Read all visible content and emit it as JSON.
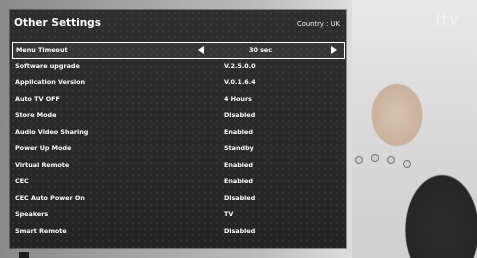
{
  "header": {
    "title": "Other Settings",
    "country": "Country : UK"
  },
  "broadcaster": {
    "logo_text": "itv"
  },
  "settings": [
    {
      "label": "Menu Timeout",
      "value": "30 sec",
      "selected": true
    },
    {
      "label": "Software upgrade",
      "value": "V.2.5.0.0"
    },
    {
      "label": "Application Version",
      "value": "V.0.1.6.4"
    },
    {
      "label": "Auto TV OFF",
      "value": "4 Hours"
    },
    {
      "label": "Store Mode",
      "value": "Disabled"
    },
    {
      "label": "Audio Video Sharing",
      "value": "Enabled"
    },
    {
      "label": "Power Up Mode",
      "value": "Standby"
    },
    {
      "label": "Virtual Remote",
      "value": "Enabled"
    },
    {
      "label": "CEC",
      "value": "Enabled"
    },
    {
      "label": "CEC  Auto Power On",
      "value": "Disabled"
    },
    {
      "label": "Speakers",
      "value": "TV"
    },
    {
      "label": "Smart Remote",
      "value": "Disabled"
    }
  ],
  "icons": {
    "left": "left-arrow-icon",
    "right": "right-arrow-icon"
  },
  "colors": {
    "panel_bg": "#2a2a2a",
    "text": "#ffffff",
    "selection_border": "#ffffff"
  }
}
